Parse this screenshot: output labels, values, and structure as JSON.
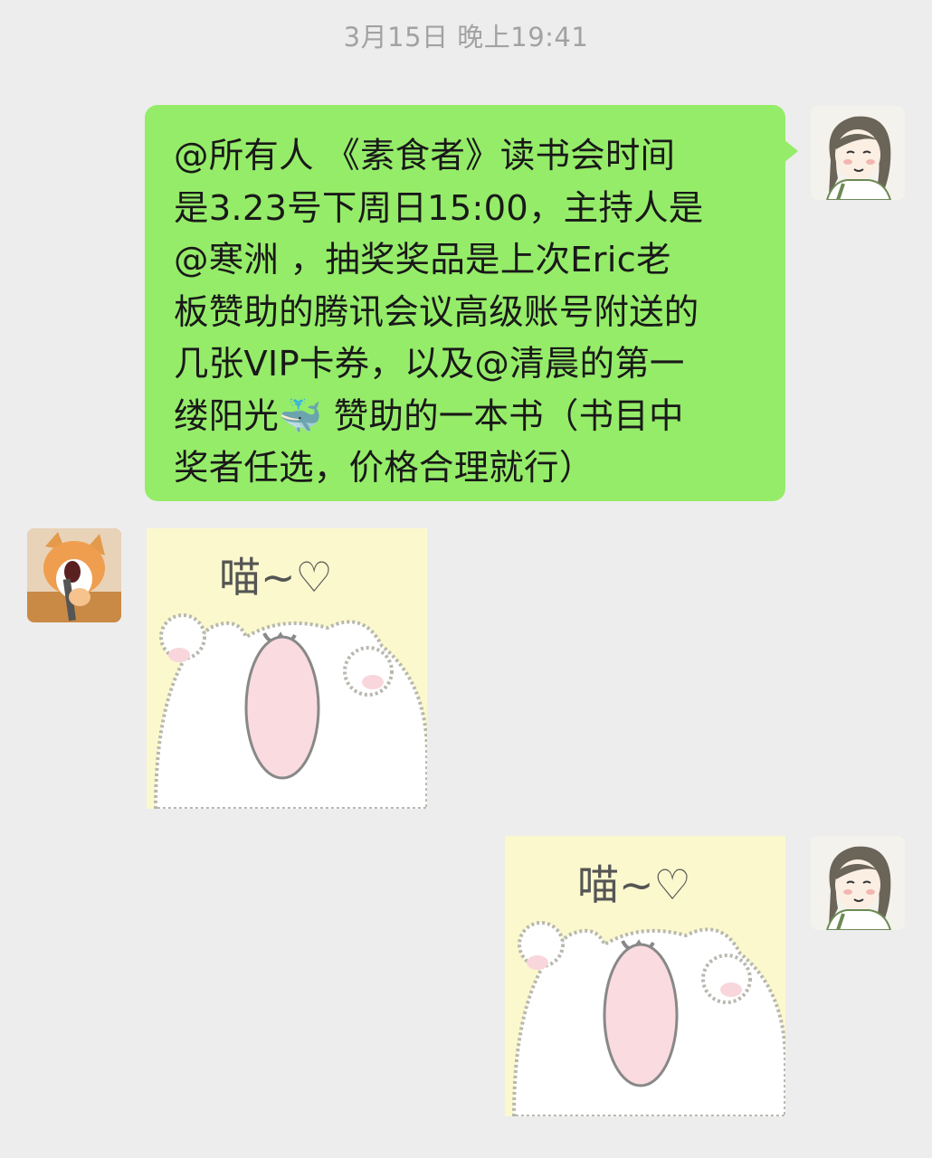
{
  "chat": {
    "timestamp": "3月15日 晚上19:41",
    "messages": [
      {
        "sender": "self",
        "type": "text",
        "lines": [
          "@所有人 《素食者》读书会时间",
          "是3.23号下周日15:00，主持人是",
          "@寒洲 ，抽奖奖品是上次Eric老",
          "板赞助的腾讯会议高级账号附送的",
          "几张VIP卡券，以及@清晨的第一",
          "缕阳光🐳 赞助的一本书（书目中",
          "奖者任选，价格合理就行）"
        ]
      },
      {
        "sender": "other",
        "type": "sticker",
        "sticker_text": "喵~♡"
      },
      {
        "sender": "self",
        "type": "sticker",
        "sticker_text": "喵~♡"
      }
    ]
  },
  "colors": {
    "background": "#ededed",
    "outgoing_bubble": "#95ec69",
    "sticker_bg": "#fbf8cd",
    "timestamp_text": "#a2a2a2"
  },
  "icons": [
    "avatar-self-girl",
    "avatar-cat-singing",
    "whale-emoji"
  ]
}
